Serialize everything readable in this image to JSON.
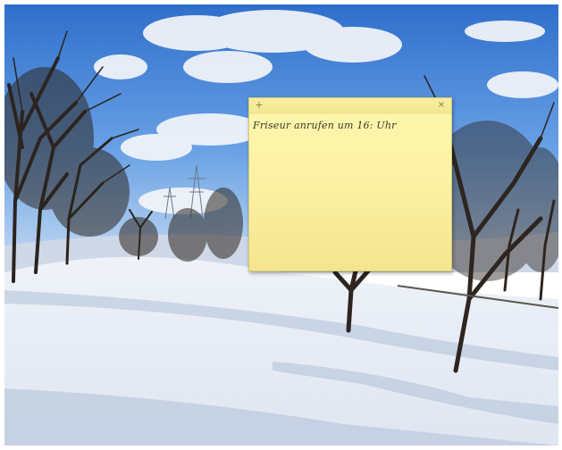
{
  "sticky_note": {
    "add_icon": "plus-icon",
    "add_glyph": "+",
    "close_icon": "close-icon",
    "close_glyph": "×",
    "text": "Friseur anrufen um 16: Uhr",
    "background_color": "#fbf1a3"
  },
  "wallpaper": {
    "scene": "snowy-landscape-with-trees",
    "sky_color": "#3d7fd4",
    "snow_color": "#f3f5f9"
  }
}
